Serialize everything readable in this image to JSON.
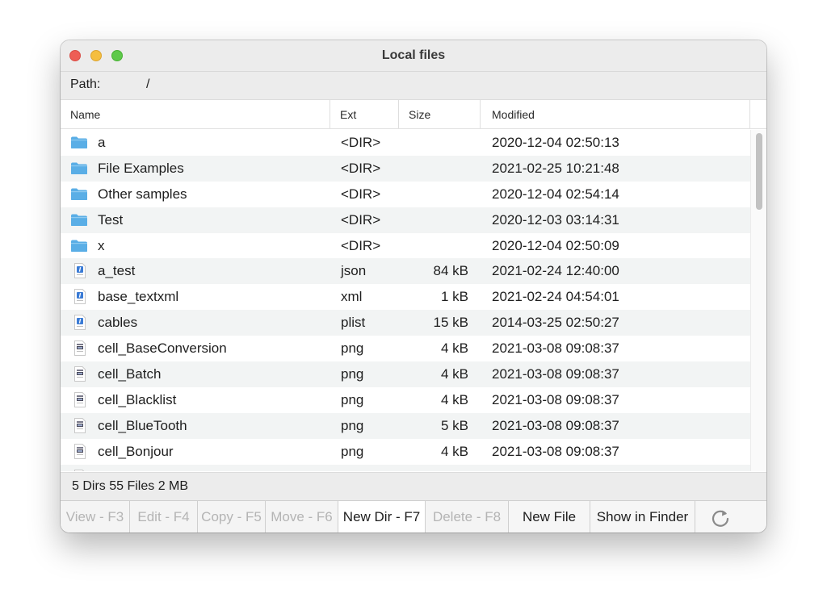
{
  "window": {
    "title": "Local files"
  },
  "path": {
    "label": "Path:",
    "value": "/"
  },
  "columns": {
    "name": "Name",
    "ext": "Ext",
    "size": "Size",
    "modified": "Modified"
  },
  "rows": [
    {
      "type": "folder",
      "name": "a",
      "ext": "<DIR>",
      "size": "",
      "modified": "2020-12-04 02:50:13"
    },
    {
      "type": "folder",
      "name": "File Examples",
      "ext": "<DIR>",
      "size": "",
      "modified": "2021-02-25 10:21:48"
    },
    {
      "type": "folder",
      "name": "Other samples",
      "ext": "<DIR>",
      "size": "",
      "modified": "2020-12-04 02:54:14"
    },
    {
      "type": "folder",
      "name": "Test",
      "ext": "<DIR>",
      "size": "",
      "modified": "2020-12-03 03:14:31"
    },
    {
      "type": "folder",
      "name": "x",
      "ext": "<DIR>",
      "size": "",
      "modified": "2020-12-04 02:50:09"
    },
    {
      "type": "text-file",
      "name": "a_test",
      "ext": "json",
      "size": "84 kB",
      "modified": "2021-02-24 12:40:00"
    },
    {
      "type": "text-file",
      "name": "base_textxml",
      "ext": "xml",
      "size": "1 kB",
      "modified": "2021-02-24 04:54:01"
    },
    {
      "type": "text-file",
      "name": "cables",
      "ext": "plist",
      "size": "15 kB",
      "modified": "2014-03-25 02:50:27"
    },
    {
      "type": "image-file",
      "name": "cell_BaseConversion",
      "ext": "png",
      "size": "4 kB",
      "modified": "2021-03-08 09:08:37"
    },
    {
      "type": "image-file",
      "name": "cell_Batch",
      "ext": "png",
      "size": "4 kB",
      "modified": "2021-03-08 09:08:37"
    },
    {
      "type": "image-file",
      "name": "cell_Blacklist",
      "ext": "png",
      "size": "4 kB",
      "modified": "2021-03-08 09:08:37"
    },
    {
      "type": "image-file",
      "name": "cell_BlueTooth",
      "ext": "png",
      "size": "5 kB",
      "modified": "2021-03-08 09:08:37"
    },
    {
      "type": "image-file",
      "name": "cell_Bonjour",
      "ext": "png",
      "size": "4 kB",
      "modified": "2021-03-08 09:08:37"
    },
    {
      "type": "image-file",
      "name": "",
      "ext": "",
      "size": "",
      "modified": ""
    }
  ],
  "status": {
    "text": "5 Dirs 55 Files 2 MB"
  },
  "buttons": [
    {
      "label": "View - F3",
      "enabled": false,
      "name": "view-button"
    },
    {
      "label": "Edit - F4",
      "enabled": false,
      "name": "edit-button"
    },
    {
      "label": "Copy - F5",
      "enabled": false,
      "name": "copy-button"
    },
    {
      "label": "Move - F6",
      "enabled": false,
      "name": "move-button"
    },
    {
      "label": "New Dir - F7",
      "enabled": true,
      "name": "new-dir-button"
    },
    {
      "label": "Delete - F8",
      "enabled": false,
      "name": "delete-button"
    },
    {
      "label": "New File",
      "enabled": true,
      "name": "new-file-button"
    },
    {
      "label": "Show in Finder",
      "enabled": true,
      "name": "show-in-finder-button"
    }
  ],
  "icons": {
    "folder": "folder-icon",
    "text_file": "text-file-icon",
    "image_file": "image-file-icon",
    "refresh": "refresh-icon"
  },
  "colors": {
    "folder": "#5aaee6",
    "row_alt": "#f2f4f4",
    "close": "#ee5e55",
    "minimize": "#f5be3f",
    "maximize": "#5ec94a"
  }
}
